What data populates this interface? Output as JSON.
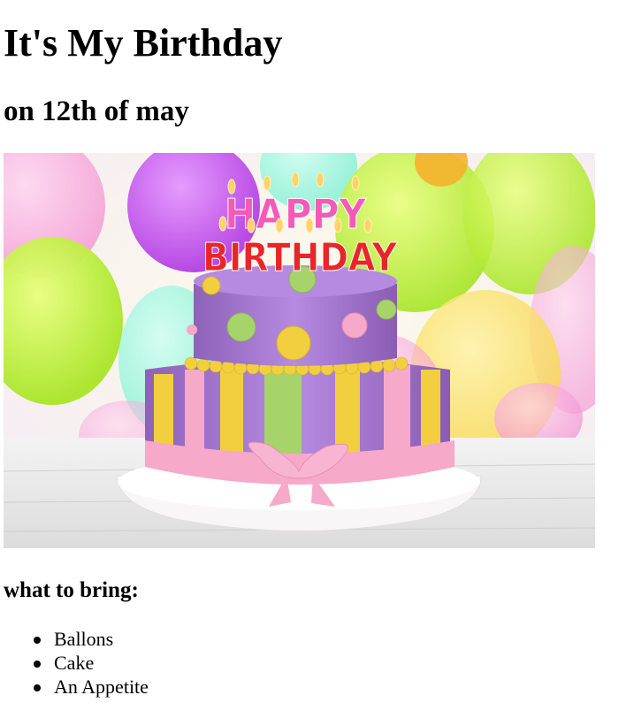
{
  "page": {
    "title": "It's My Birthday",
    "subtitle": "on 12th of may"
  },
  "image": {
    "alt": "birthday-cake-photo",
    "cake_text": [
      "HAPPY",
      "BIRTHDAY"
    ]
  },
  "section": {
    "heading": "what to bring:"
  },
  "items": [
    "Ballons",
    "Cake",
    "An Appetite"
  ],
  "colors": {
    "text": "#000000",
    "background": "#ffffff",
    "cake_purple": "#a57bd0",
    "cake_pink": "#f6a9c9",
    "cake_yellow": "#f2cf3f",
    "cake_green": "#a7d46a"
  }
}
